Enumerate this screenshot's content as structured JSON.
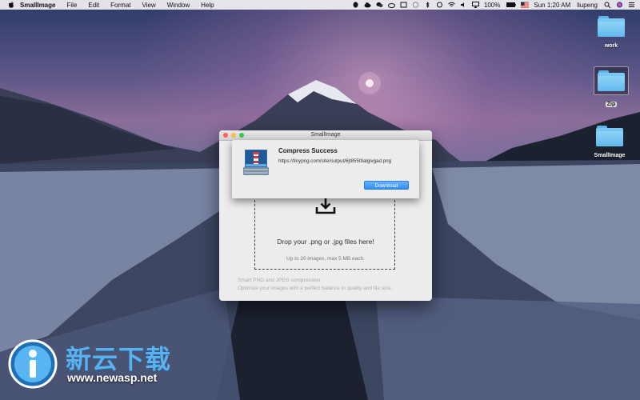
{
  "menubar": {
    "app_name": "SmallImage",
    "menus": [
      "File",
      "Edit",
      "Format",
      "View",
      "Window",
      "Help"
    ],
    "battery": "100%",
    "clock": "Sun 1:20 AM",
    "user": "liupeng"
  },
  "desktop": {
    "icons": [
      {
        "label": "work",
        "selected": false
      },
      {
        "label": "Zip",
        "selected": true
      },
      {
        "label": "SmallImage",
        "selected": false
      }
    ]
  },
  "window": {
    "title": "SmallImage",
    "drop_main": "Drop your .png or .jpg files here!",
    "drop_sub": "Up to 20 images, max 5 MB each.",
    "footer_line1": "Smart PNG and JPEG compression",
    "footer_line2": "Optimize your images with a perfect balance in quality and file size."
  },
  "sheet": {
    "title": "Compress Success",
    "url": "https://tinypng.com/site/output/6jt855t9algivgad.png",
    "download_label": "Download"
  },
  "watermark": {
    "cn": "新云下载",
    "url": "www.newasp.net"
  },
  "colors": {
    "accent_blue": "#2f8cf5",
    "folder_blue": "#62b8ec"
  }
}
